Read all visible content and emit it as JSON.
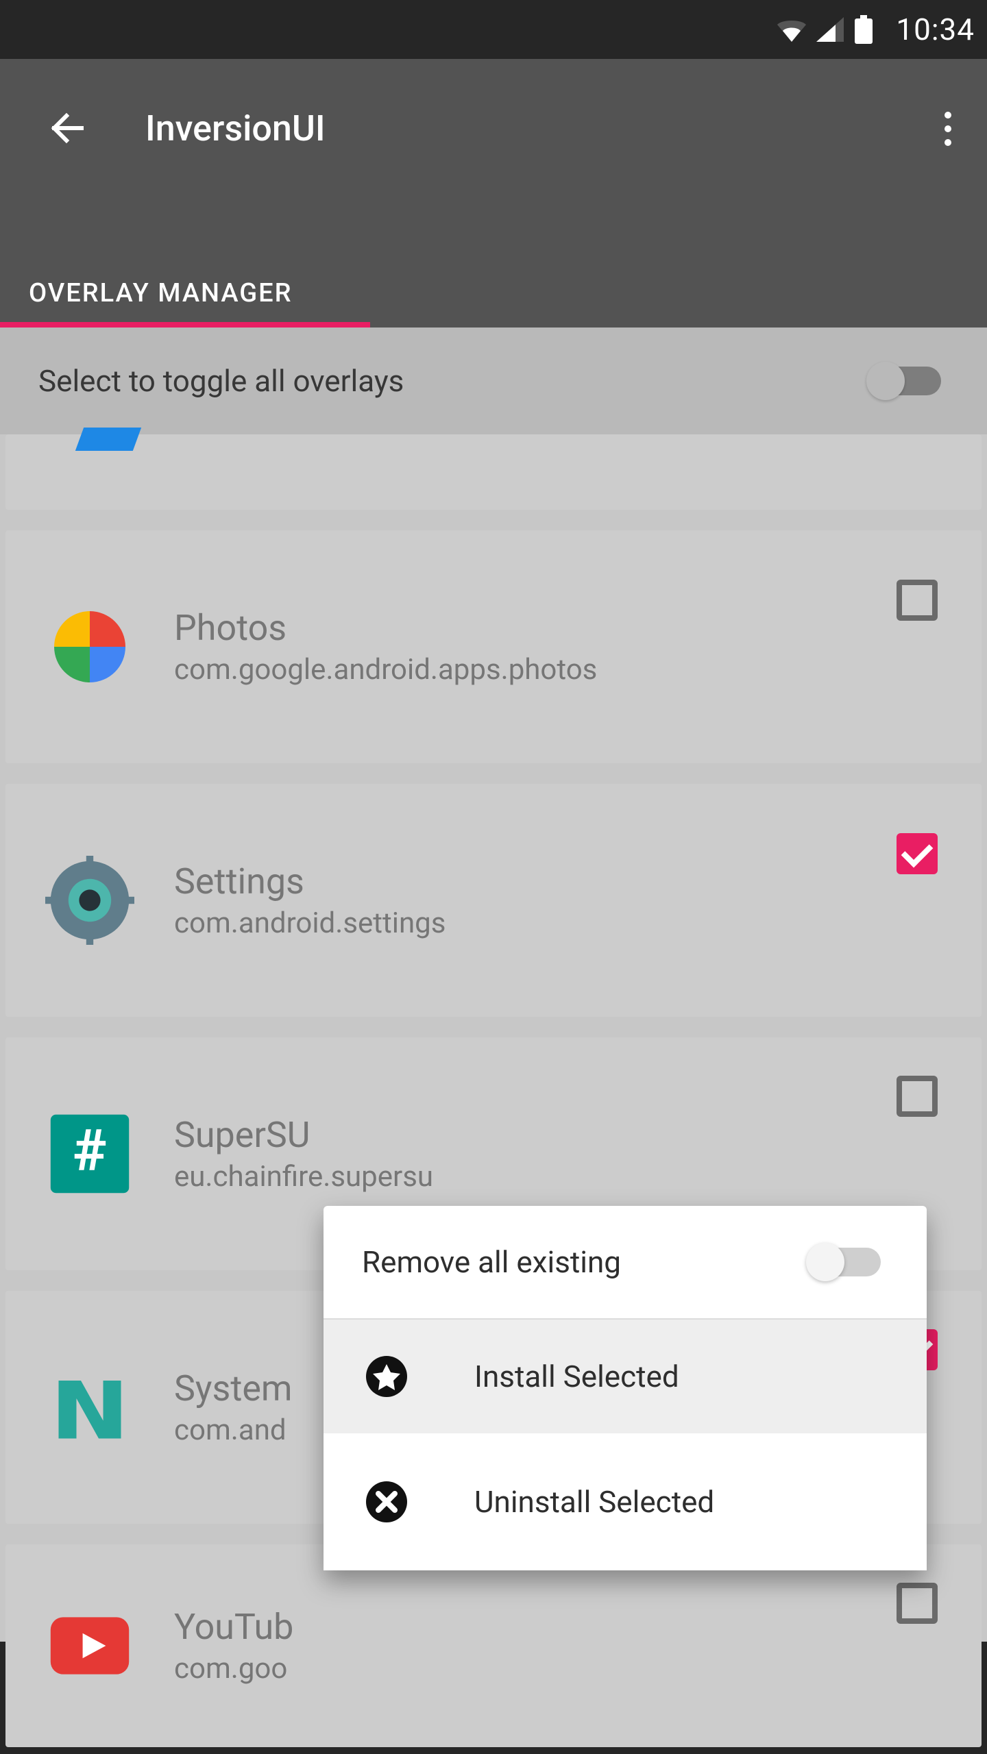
{
  "status": {
    "time": "10:34"
  },
  "header": {
    "title": "InversionUI",
    "tab": "OVERLAY MANAGER"
  },
  "subheader": {
    "toggle_all_label": "Select to toggle all overlays",
    "toggle_all_on": false
  },
  "apps": [
    {
      "name": "Photos",
      "pkg": "com.google.android.apps.photos",
      "checked": false,
      "icon": "photos"
    },
    {
      "name": "Settings",
      "pkg": "com.android.settings",
      "checked": true,
      "icon": "settings"
    },
    {
      "name": "SuperSU",
      "pkg": "eu.chainfire.supersu",
      "checked": false,
      "icon": "supersu"
    },
    {
      "name": "System",
      "pkg": "com.and",
      "checked": true,
      "icon": "android-n"
    },
    {
      "name": "YouTub",
      "pkg": "com.goo",
      "checked": false,
      "icon": "youtube"
    }
  ],
  "popup": {
    "remove_label": "Remove all existing",
    "remove_on": false,
    "install_label": "Install Selected",
    "uninstall_label": "Uninstall Selected"
  }
}
